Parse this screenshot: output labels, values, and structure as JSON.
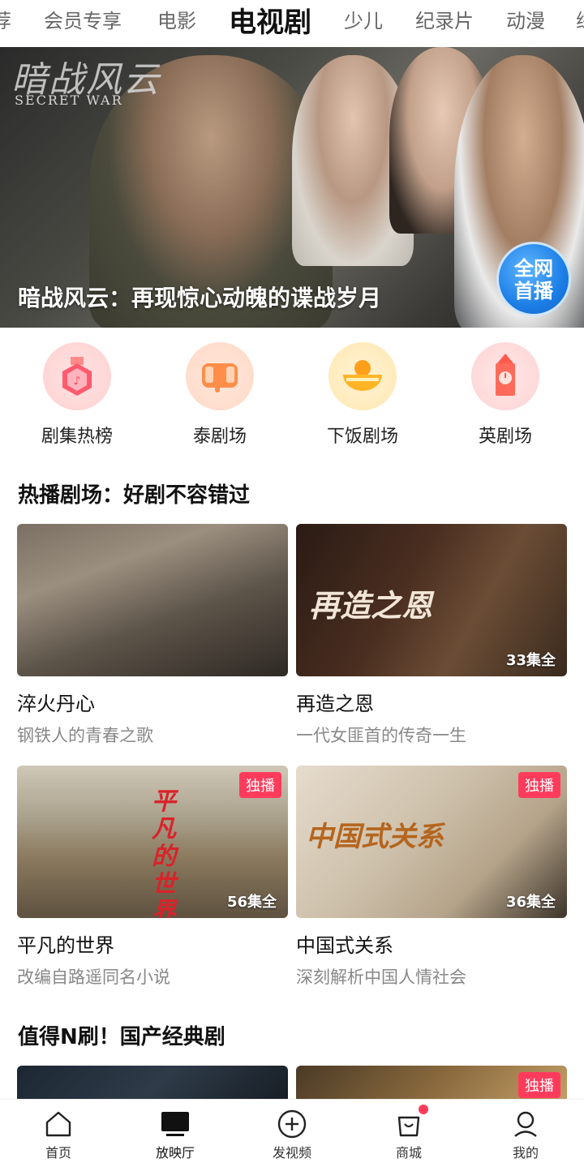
{
  "top_tabs": [
    {
      "label": "荐"
    },
    {
      "label": "会员专享"
    },
    {
      "label": "电影"
    },
    {
      "label": "电视剧",
      "active": true
    },
    {
      "label": "少儿"
    },
    {
      "label": "纪录片"
    },
    {
      "label": "动漫"
    },
    {
      "label": "综"
    }
  ],
  "banner": {
    "logo_cn": "暗战风云",
    "logo_en": "SECRET WAR",
    "caption": "暗战风云：再现惊心动魄的谍战岁月",
    "badge_line1": "全网",
    "badge_line2": "首播",
    "slide_count": 4,
    "active_slide": 1
  },
  "quick_links": [
    {
      "label": "剧集热榜",
      "icon": "medal-icon"
    },
    {
      "label": "泰剧场",
      "icon": "elephant-icon"
    },
    {
      "label": "下饭剧场",
      "icon": "food-bowl-icon"
    },
    {
      "label": "英剧场",
      "icon": "big-ben-icon"
    }
  ],
  "section1": {
    "title": "热播剧场：好剧不容错过",
    "cards": [
      {
        "title": "淬火丹心",
        "sub": "钢铁人的青春之歌",
        "count": "",
        "tag": "",
        "thumb_text": ""
      },
      {
        "title": "再造之恩",
        "sub": "一代女匪首的传奇一生",
        "count": "33集全",
        "tag": "",
        "thumb_text": "再造之恩"
      },
      {
        "title": "平凡的世界",
        "sub": "改编自路遥同名小说",
        "count": "56集全",
        "tag": "独播",
        "thumb_text": "平凡的世界"
      },
      {
        "title": "中国式关系",
        "sub": "深刻解析中国人情社会",
        "count": "36集全",
        "tag": "独播",
        "thumb_text": "中国式关系"
      }
    ]
  },
  "section2": {
    "title": "值得N刷！国产经典剧",
    "cards": [
      {
        "tag": ""
      },
      {
        "tag": "独播"
      }
    ]
  },
  "bottom_nav": [
    {
      "label": "首页",
      "icon": "home-icon"
    },
    {
      "label": "放映厅",
      "icon": "tv-icon",
      "active": true
    },
    {
      "label": "发视频",
      "icon": "plus-circle-icon"
    },
    {
      "label": "商城",
      "icon": "shopping-bag-icon",
      "badge": true
    },
    {
      "label": "我的",
      "icon": "profile-icon"
    }
  ],
  "colors": {
    "accent_red": "#ff3b5c",
    "badge_blue": "#1d7fe6",
    "text_primary": "#111111",
    "text_secondary": "#888888"
  }
}
